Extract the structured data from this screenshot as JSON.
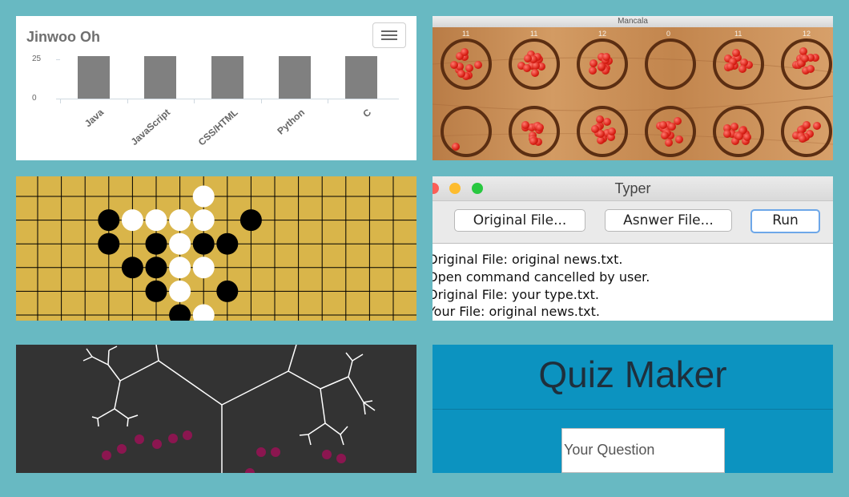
{
  "portfolio": {
    "brand": "Jinwoo Oh",
    "menu_icon": "hamburger-icon",
    "chart_data": {
      "type": "bar",
      "categories": [
        "Java",
        "JavaScript",
        "CSS/HTML",
        "Python",
        "C"
      ],
      "values": [
        27,
        27,
        27,
        27,
        27
      ],
      "ytick_labels": [
        "25",
        "0"
      ],
      "ylim": [
        0,
        27
      ],
      "grid": false,
      "colors": {
        "bar": "#808080"
      }
    }
  },
  "mancala": {
    "window_title": "Mancala",
    "top_counts": [
      "11",
      "11",
      "12",
      "0",
      "11",
      "12"
    ],
    "colors": {
      "board": "#c98e57",
      "stone": "#d81e14",
      "pit_ring": "#5b2e12"
    }
  },
  "go": {
    "colors": {
      "board": "#d9b54a",
      "black": "#000000",
      "white": "#ffffff"
    }
  },
  "typer": {
    "window_title": "Typer",
    "buttons": {
      "original": "Original File...",
      "answer": "Asnwer File...",
      "run": "Run"
    },
    "console_lines": [
      "Original File: original news.txt.",
      "Open command cancelled by user.",
      "Original File: your type.txt.",
      "Your File: original news.txt."
    ]
  },
  "tree": {
    "colors": {
      "background": "#333333",
      "branch": "#ffffff",
      "dot": "#8b1650"
    }
  },
  "quiz": {
    "title": "Quiz Maker",
    "input_placeholder": "Your Question",
    "colors": {
      "background": "#0c93c0"
    }
  }
}
